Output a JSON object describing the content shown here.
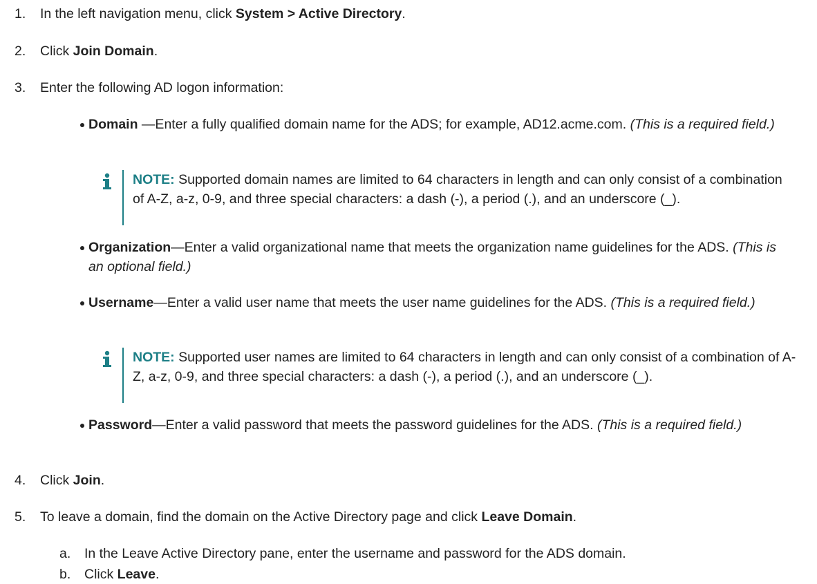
{
  "colors": {
    "text": "#222222",
    "accent": "#1d7f86"
  },
  "steps": [
    {
      "num": "1.",
      "pre": "In the left navigation menu, click ",
      "bold": "System > Active Directory",
      "post": "."
    },
    {
      "num": "2.",
      "pre": "Click ",
      "bold": "Join Domain",
      "post": "."
    },
    {
      "num": "3.",
      "text": "Enter the following AD logon information:"
    },
    {
      "num": "4.",
      "pre": "Click ",
      "bold": "Join",
      "post": "."
    },
    {
      "num": "5.",
      "pre": "To leave a domain, find the domain on the Active Directory page and click ",
      "bold": "Leave Domain",
      "post": "."
    }
  ],
  "fields": [
    {
      "name": "Domain",
      "desc": " —Enter a fully qualified domain name for the ADS; for example, AD12.acme.com. ",
      "note": "(This is a required field.)"
    },
    {
      "name": "Organization",
      "desc": "—Enter a valid organizational name that meets the organization name guidelines for the ADS. ",
      "note": "(This is an optional field.)"
    },
    {
      "name": "Username",
      "desc": "—Enter a valid user name that meets the user name guidelines for the ADS. ",
      "note": "(This is a required field.)"
    },
    {
      "name": "Password",
      "desc": "—Enter a valid password that meets the password guidelines for the ADS. ",
      "note": "(This is a required field.)"
    }
  ],
  "notes": [
    {
      "label": "NOTE:",
      "text": " Supported domain names are limited to 64 characters in length and can only consist of a combination of A-Z, a-z, 0-9, and three special characters: a dash (-), a period (.), and an underscore (_)."
    },
    {
      "label": "NOTE:",
      "text": " Supported user names are limited to 64 characters in length and can only consist of a combination of A-Z, a-z, 0-9, and three special characters: a dash (-), a period (.), and an underscore (_)."
    }
  ],
  "substeps": [
    {
      "num": "a.",
      "text": "In the Leave Active Directory pane, enter the username and password for the ADS domain."
    },
    {
      "num": "b.",
      "pre": "Click ",
      "bold": "Leave",
      "post": "."
    }
  ]
}
